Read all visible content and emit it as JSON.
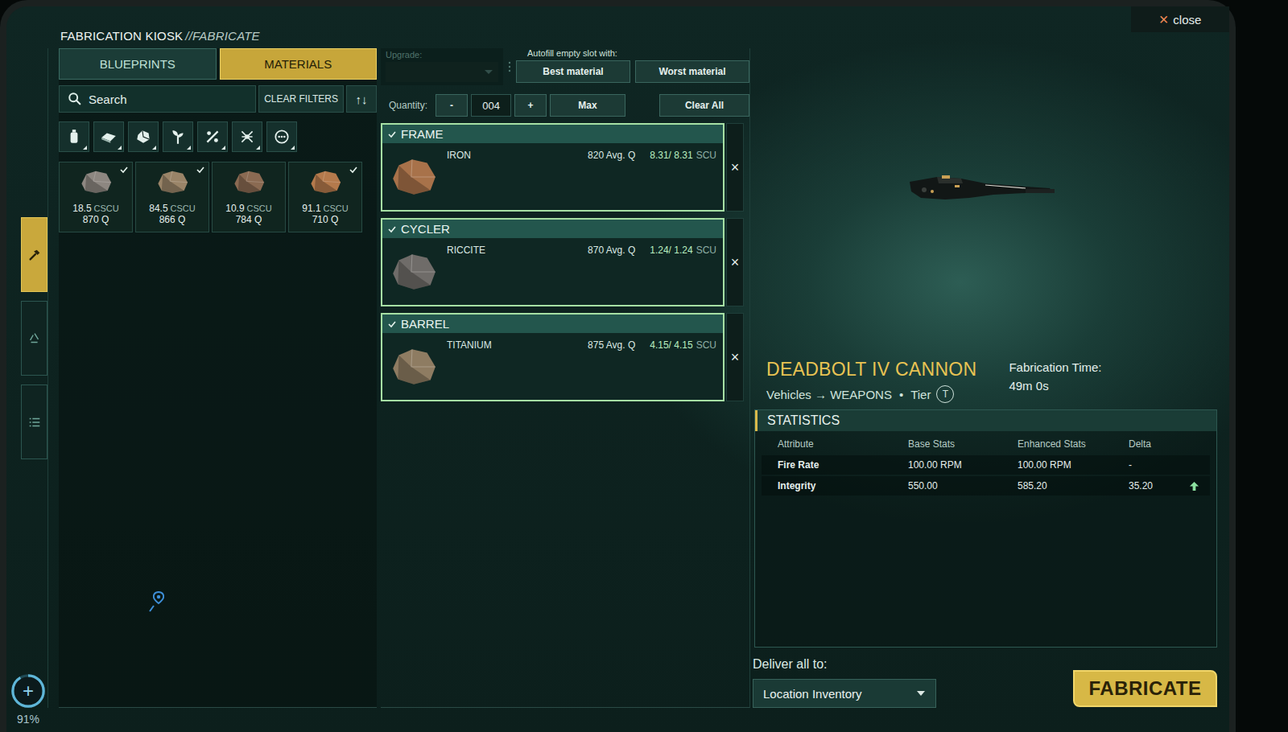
{
  "header": {
    "title": "FABRICATION KIOSK",
    "subtitle": "//FABRICATE",
    "close": {
      "icon": "×",
      "label": "close"
    }
  },
  "rail": [
    {
      "kind": "hammer",
      "selected": true
    },
    {
      "kind": "recycle",
      "selected": false
    },
    {
      "kind": "list",
      "selected": false
    }
  ],
  "status": {
    "icon": "+",
    "level": 0.91,
    "reading": "91%"
  },
  "left": {
    "tabs": [
      {
        "label": "BLUEPRINTS",
        "selected": false
      },
      {
        "label": "MATERIALS",
        "selected": true
      }
    ],
    "search": {
      "placeholder": "Search"
    },
    "clear_filters": "CLEAR FILTERS",
    "sort": "↑↓",
    "filters": [
      {
        "kind": "canister"
      },
      {
        "kind": "ingot"
      },
      {
        "kind": "ore"
      },
      {
        "kind": "plant"
      },
      {
        "kind": "percent"
      },
      {
        "kind": "network"
      },
      {
        "kind": "more"
      }
    ],
    "materials": [
      {
        "amount": "18.5",
        "unit": "CSCU",
        "quality": "870 Q",
        "checked": true,
        "color": "#8d8781"
      },
      {
        "amount": "84.5",
        "unit": "CSCU",
        "quality": "866 Q",
        "checked": true,
        "color": "#9a8468"
      },
      {
        "amount": "10.9",
        "unit": "CSCU",
        "quality": "784 Q",
        "checked": false,
        "color": "#8a6a52"
      },
      {
        "amount": "91.1",
        "unit": "CSCU",
        "quality": "710 Q",
        "checked": true,
        "color": "#b47a4c"
      }
    ]
  },
  "fabrication": {
    "upgrade": {
      "label": "Upgrade:",
      "value": "",
      "disabled": true
    },
    "autofill": {
      "label": "Autofill empty slot with:",
      "buttons": [
        "Best material",
        "Worst material"
      ]
    },
    "quantity": {
      "label": "Quantity:",
      "minus": "-",
      "value": "004",
      "plus": "+",
      "max": "Max"
    },
    "clear_all": "Clear All",
    "slots": [
      {
        "name": "FRAME",
        "checked": true,
        "material": "IRON",
        "quality": "820 Avg. Q",
        "amount": "8.31/ 8.31",
        "unit": "SCU",
        "remove": "×",
        "color": "#a8724a"
      },
      {
        "name": "CYCLER",
        "checked": true,
        "material": "RICCITE",
        "quality": "870 Avg. Q",
        "amount": "1.24/ 1.24",
        "unit": "SCU",
        "remove": "×",
        "color": "#6f6c69"
      },
      {
        "name": "BARREL",
        "checked": true,
        "material": "TITANIUM",
        "quality": "875 Avg. Q",
        "amount": "4.15/ 4.15",
        "unit": "SCU",
        "remove": "×",
        "color": "#8e7c62"
      }
    ]
  },
  "item": {
    "name": "DEADBOLT IV CANNON",
    "category": "Vehicles → WEAPONS",
    "separator": "•",
    "tier_label": "Tier",
    "tier": "T",
    "time_label": "Fabrication Time:",
    "time": "49m 0s"
  },
  "statistics": {
    "title": "STATISTICS",
    "columns": [
      "Attribute",
      "Base Stats",
      "Enhanced Stats",
      "Delta"
    ],
    "rows": [
      {
        "attribute": "Fire Rate",
        "base": "100.00 RPM",
        "enhanced": "100.00 RPM",
        "delta": "-",
        "trend": "none"
      },
      {
        "attribute": "Integrity",
        "base": "550.00",
        "enhanced": "585.20",
        "delta": "35.20",
        "trend": "up"
      }
    ]
  },
  "delivery": {
    "label": "Deliver all to:",
    "value": "Location Inventory"
  },
  "fabricate": "FABRICATE"
}
